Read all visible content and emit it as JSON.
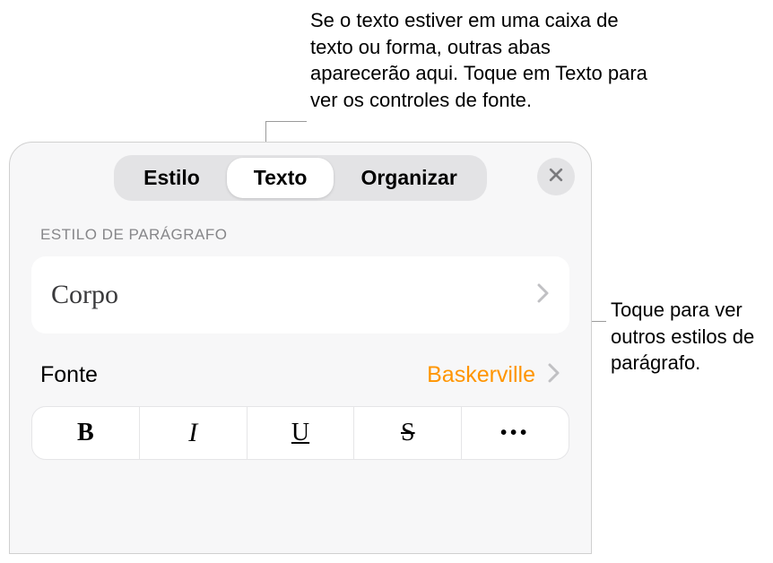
{
  "callouts": {
    "top": "Se o texto estiver em uma caixa de texto ou forma, outras abas aparecerão aqui. Toque em Texto para ver os controles de fonte.",
    "right": "Toque para ver outros estilos de parágrafo."
  },
  "tabs": {
    "style": "Estilo",
    "text": "Texto",
    "arrange": "Organizar"
  },
  "section": {
    "paragraph_style_label": "ESTILO DE PARÁGRAFO",
    "current_style": "Corpo"
  },
  "font": {
    "label": "Fonte",
    "value": "Baskerville"
  },
  "format": {
    "bold": "B",
    "italic": "I",
    "underline": "U",
    "strike": "S",
    "more": "•••"
  }
}
